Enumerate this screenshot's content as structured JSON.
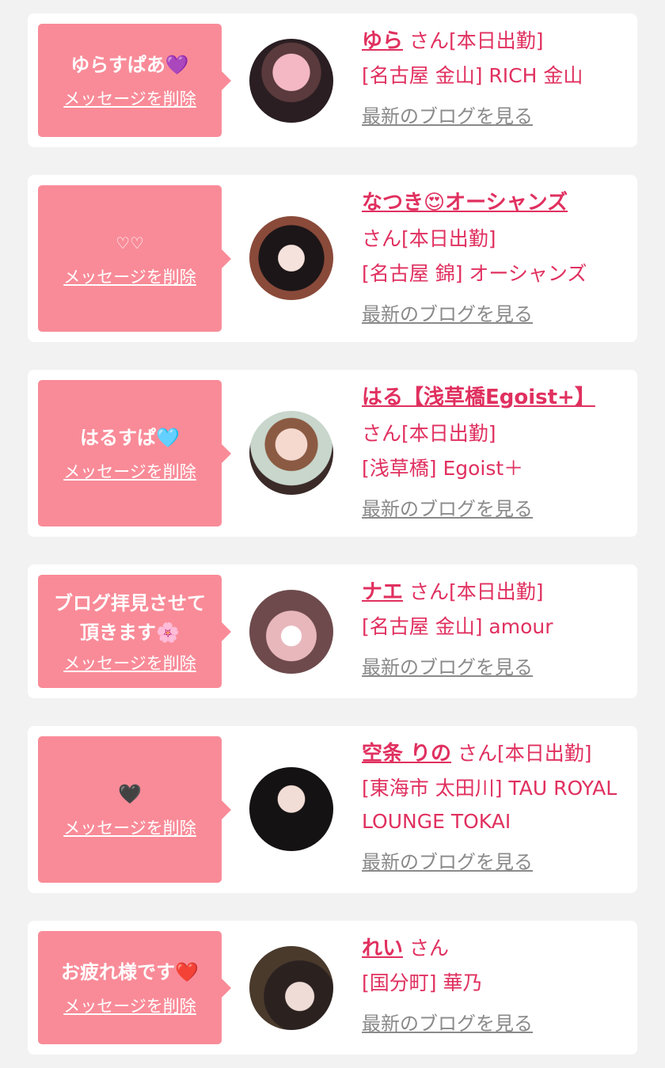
{
  "colors": {
    "accent": "#e0305f",
    "bubble": "#f98b98",
    "background": "#f2f2f2",
    "link_gray": "#8a8a8a"
  },
  "labels": {
    "delete": "メッセージを削除",
    "blog": "最新のブログを見る"
  },
  "entries": [
    {
      "message": "ゆらすぱあ💜",
      "name": "ゆら",
      "san": "さん",
      "status": "[本日出勤]",
      "store": "[名古屋 金山] RICH 金山"
    },
    {
      "message": "♡♡",
      "name": "なつき😍オーシャンズ",
      "san": "さん",
      "status": "[本日出勤]",
      "store": "[名古屋 錦] オーシャンズ"
    },
    {
      "message": "はるすぱ🩵",
      "name": "はる【浅草橋Egoist+】",
      "san": "さん",
      "status": "[本日出勤]",
      "store": "[浅草橋] Egoist＋"
    },
    {
      "message": "ブログ拝見させて\n頂きます🌸",
      "name": "ナエ",
      "san": "さん",
      "status": "[本日出勤]",
      "store": "[名古屋 金山] amour"
    },
    {
      "message": "🖤",
      "name": "空条 りの",
      "san": "さん",
      "status": "[本日出勤]",
      "store": "[東海市 太田川] TAU ROYAL LOUNGE TOKAI"
    },
    {
      "message": "お疲れ様です❤️",
      "name": "れい",
      "san": "さん",
      "status": "",
      "store": "[国分町] 華乃"
    }
  ]
}
